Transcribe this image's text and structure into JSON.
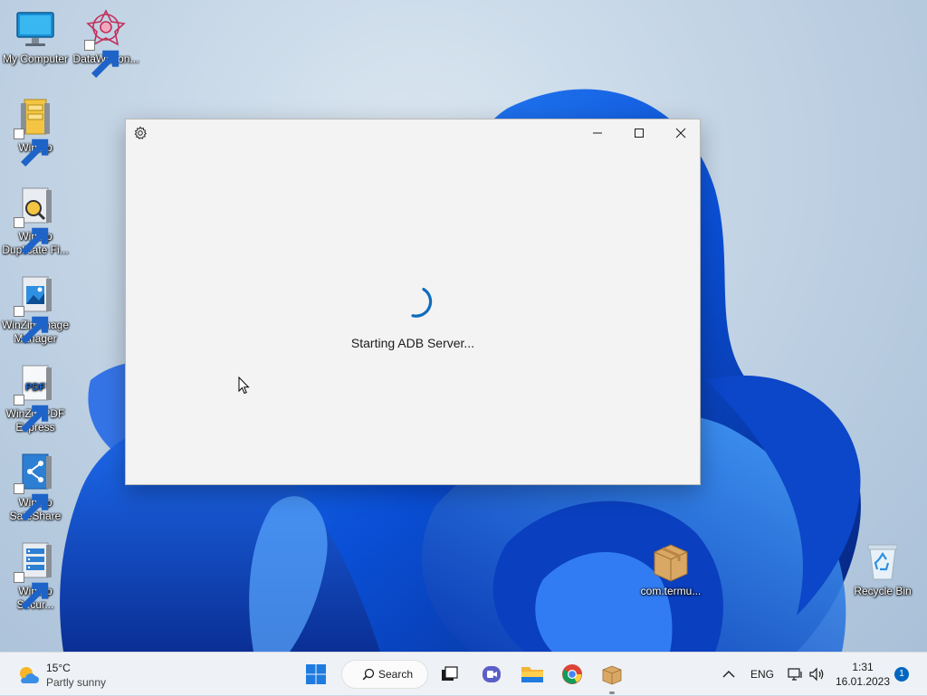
{
  "desktop": {
    "icons": [
      {
        "label": "My Computer",
        "icon": "monitor-icon"
      },
      {
        "label": "DataWagon...",
        "icon": "datawagon-icon"
      },
      {
        "label": "WinZip",
        "icon": "winzip-icon"
      },
      {
        "label": "WinZip Duplicate Fi...",
        "icon": "winzip-duplicate-icon"
      },
      {
        "label": "WinZip Image Manager",
        "icon": "winzip-image-icon"
      },
      {
        "label": "WinZip PDF Express",
        "icon": "winzip-pdf-icon"
      },
      {
        "label": "WinZip SafeShare",
        "icon": "winzip-safeshare-icon"
      },
      {
        "label": "WinZip Secur...",
        "icon": "winzip-secure-icon"
      },
      {
        "label": "com.termu...",
        "icon": "package-box-icon"
      },
      {
        "label": "Recycle Bin",
        "icon": "recycle-bin-icon"
      }
    ],
    "pdf_glyph": "PDF"
  },
  "app_window": {
    "status": "Starting ADB Server...",
    "accent": "#0f6cbd"
  },
  "taskbar": {
    "weather_temp": "15°C",
    "weather_condition": "Partly sunny",
    "search_label": "Search",
    "language": "ENG",
    "time": "1:31",
    "date": "16.01.2023",
    "notification_count": "1"
  },
  "colors": {
    "accent": "#0067c0",
    "window_bg": "#f3f3f3",
    "taskbar_bg": "#eef1f5"
  }
}
